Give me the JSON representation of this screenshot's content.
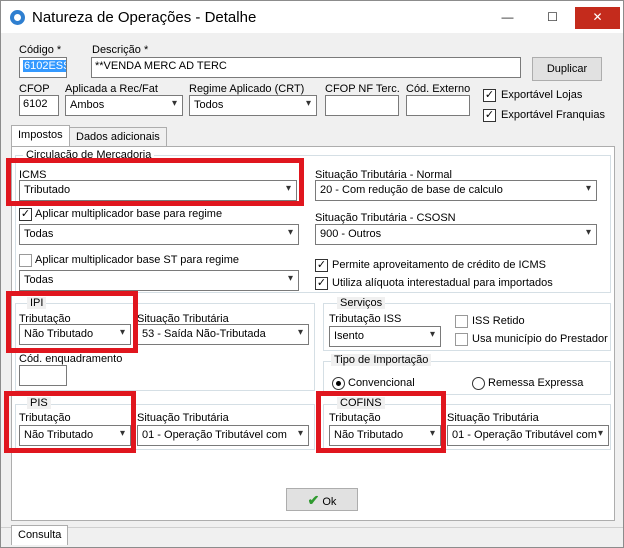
{
  "window": {
    "title": "Natureza de Operações - Detalhe",
    "min_glyph": "—",
    "max_glyph": "☐",
    "close_glyph": "✕"
  },
  "header": {
    "codigo_label": "Código *",
    "codigo_value": "6102ESS",
    "descricao_label": "Descrição *",
    "descricao_value": "**VENDA MERC AD TERC",
    "duplicar_button": "Duplicar",
    "cfop_label": "CFOP",
    "cfop_value": "6102",
    "aplicada_label": "Aplicada a Rec/Fat",
    "aplicada_value": "Ambos",
    "regime_label": "Regime Aplicado (CRT)",
    "regime_value": "Todos",
    "cfop_nf_label": "CFOP NF Terc.",
    "cfop_nf_value": "",
    "cod_externo_label": "Cód. Externo",
    "cod_externo_value": "",
    "exportavel_lojas": "Exportável Lojas",
    "exportavel_franquias": "Exportável Franquias"
  },
  "tabs": [
    {
      "label": "Impostos",
      "active": true
    },
    {
      "label": "Dados adicionais",
      "active": false
    }
  ],
  "impostos": {
    "circulacao_title": "Circulação de Mercadoria",
    "icms_label": "ICMS",
    "icms_value": "Tributado",
    "sit_normal_label": "Situação Tributária - Normal",
    "sit_normal_value": "20 - Com redução de base de calculo",
    "aplicar_mult_label": "Aplicar multiplicador base para regime",
    "aplicar_mult_value": "Todas",
    "sit_csosn_label": "Situação Tributária - CSOSN",
    "sit_csosn_value": "900 - Outros",
    "aplicar_mult_st_label": "Aplicar multiplicador base ST para regime",
    "aplicar_mult_st_value": "Todas",
    "permite_credito_label": "Permite aproveitamento de crédito de ICMS",
    "utiliza_aliquota_label": "Utiliza alíquota interestadual para importados",
    "ipi_title": "IPI",
    "ipi_trib_label": "Tributação",
    "ipi_trib_value": "Não Tributado",
    "ipi_sit_label": "Situação Tributária",
    "ipi_sit_value": "53 - Saída Não-Tributada",
    "cod_enq_label": "Cód. enquadramento",
    "cod_enq_value": "",
    "servicos_title": "Serviços",
    "trib_iss_label": "Tributação ISS",
    "trib_iss_value": "Isento",
    "iss_retido_label": "ISS Retido",
    "usa_municipio_label": "Usa município do Prestador",
    "tipo_importacao_title": "Tipo de Importação",
    "convencional_label": "Convencional",
    "remessa_label": "Remessa Expressa",
    "pis_title": "PIS",
    "pis_trib_label": "Tributação",
    "pis_trib_value": "Não Tributado",
    "pis_sit_label": "Situação Tributária",
    "pis_sit_value": "01 - Operação Tributável com",
    "cofins_title": "COFINS",
    "cofins_trib_label": "Tributação",
    "cofins_trib_value": "Não Tributado",
    "cofins_sit_label": "Situação Tributária",
    "cofins_sit_value": "01 - Operação Tributável com"
  },
  "footer": {
    "ok_button": "Ok",
    "consulta_tab": "Consulta"
  },
  "colors": {
    "highlight_box": "#e0161e",
    "selection": "#3399ff"
  }
}
